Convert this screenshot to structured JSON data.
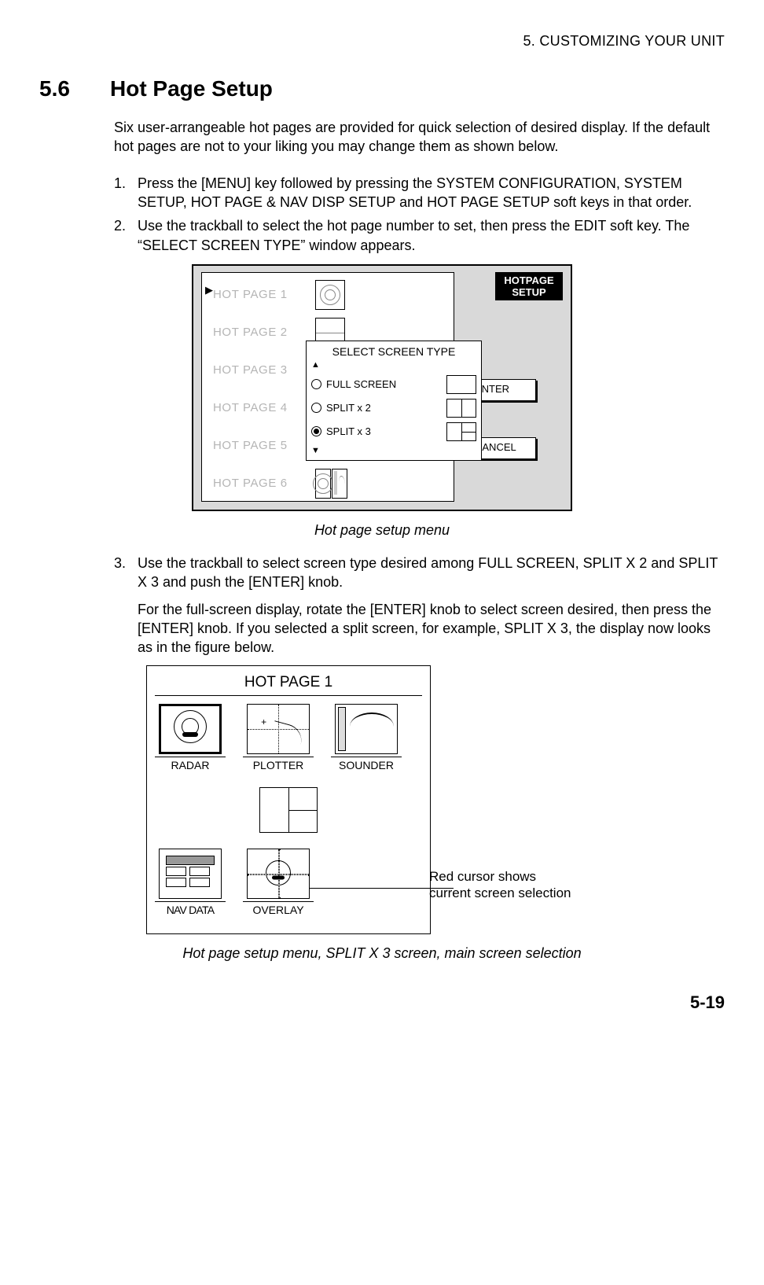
{
  "header": {
    "chapter": "5. CUSTOMIZING YOUR UNIT"
  },
  "section": {
    "number": "5.6",
    "title": "Hot Page Setup"
  },
  "intro": "Six user-arrangeable hot pages are provided for quick selection of desired display. If the default hot pages are not to your liking you may change them as shown below.",
  "steps": {
    "s1": "Press the [MENU] key followed by pressing the SYSTEM CONFIGURATION, SYSTEM SETUP, HOT PAGE & NAV DISP SETUP and HOT PAGE SETUP soft keys in that order.",
    "s2": "Use the trackball to select the hot page number to set, then press the EDIT soft key. The “SELECT SCREEN TYPE” window appears.",
    "s3": "Use the trackball to select screen type desired among FULL SCREEN, SPLIT X 2 and SPLIT X 3 and push the [ENTER] knob.",
    "s3_para": "For the full-screen display, rotate the [ENTER] knob to select screen desired, then press the [ENTER] knob. If you selected a split screen, for example, SPLIT X 3, the display now looks as in the figure below."
  },
  "fig1": {
    "hp1": "HOT PAGE 1",
    "hp2": "HOT PAGE 2",
    "hp3": "HOT PAGE 3",
    "hp4": "HOT PAGE 4",
    "hp5": "HOT PAGE 5",
    "hp6": "HOT PAGE 6",
    "popup_title": "SELECT SCREEN TYPE",
    "opt_full": "FULL SCREEN",
    "opt_split2": "SPLIT x 2",
    "opt_split3": "SPLIT x 3",
    "tag_line1": "HOTPAGE",
    "tag_line2": "SETUP",
    "enter": "ENTER",
    "cancel": "CANCEL",
    "caption": "Hot page setup menu"
  },
  "fig2": {
    "title": "HOT PAGE 1",
    "radar": "RADAR",
    "plotter": "PLOTTER",
    "sounder": "SOUNDER",
    "navdata": "NAV DATA",
    "overlay": "OVERLAY",
    "callout_l1": "Red cursor shows",
    "callout_l2": "current screen selection",
    "caption": "Hot page setup menu, SPLIT X 3 screen, main screen selection"
  },
  "page_num": "5-19"
}
